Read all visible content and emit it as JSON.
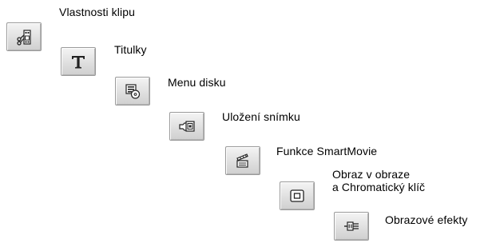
{
  "tools": [
    {
      "id": "clip-properties",
      "icon": "clip-properties-icon",
      "label": "Vlastnosti klipu"
    },
    {
      "id": "titles",
      "icon": "title-t-icon",
      "label": "Titulky"
    },
    {
      "id": "disc-menu",
      "icon": "disc-menu-icon",
      "label": "Menu disku"
    },
    {
      "id": "frame-grab",
      "icon": "frame-grab-icon",
      "label": "Uložení snímku"
    },
    {
      "id": "smartmovie",
      "icon": "clapperboard-icon",
      "label": "Funkce SmartMovie"
    },
    {
      "id": "pip-chroma",
      "icon": "picture-in-picture-icon",
      "label_line1": "Obraz v obraze",
      "label_line2": "a Chromatický klíč"
    },
    {
      "id": "video-effects",
      "icon": "video-effects-plug-icon",
      "label": "Obrazové efekty"
    }
  ]
}
